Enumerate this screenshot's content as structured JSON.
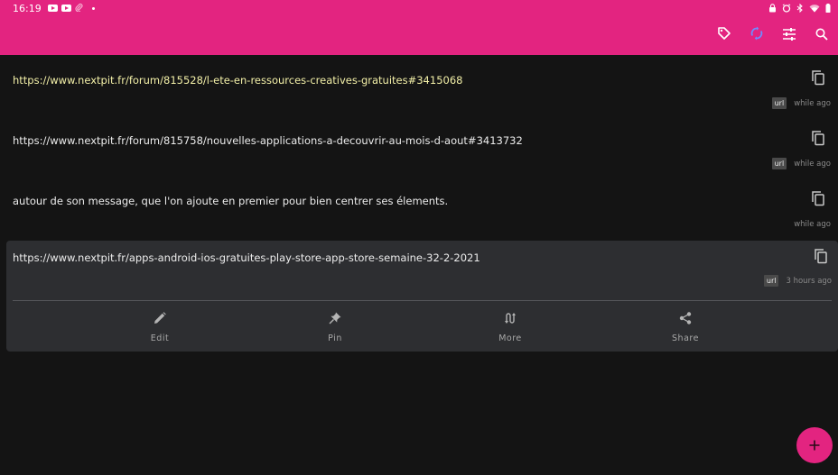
{
  "status_bar": {
    "time": "16:19",
    "left_icons": [
      "youtube-icon",
      "youtube-icon",
      "attachment-icon",
      "dot-icon"
    ],
    "right_icons": [
      "lock-icon",
      "alarm-icon",
      "bluetooth-icon",
      "wifi-icon",
      "battery-icon"
    ]
  },
  "app_bar": {
    "actions": [
      "tag-icon",
      "sync-icon",
      "filter-sliders-icon",
      "search-icon"
    ],
    "accent_color": "#e32480",
    "sync_color": "#6e8cff"
  },
  "items": [
    {
      "text": "https://www.nextpit.fr/forum/815528/l-ete-en-ressources-creatives-gratuites#3415068",
      "badge": "url",
      "time": "while ago",
      "highlighted": true
    },
    {
      "text": "https://www.nextpit.fr/forum/815758/nouvelles-applications-a-decouvrir-au-mois-d-aout#3413732",
      "badge": "url",
      "time": "while ago"
    },
    {
      "text": "autour de son message, que l'on ajoute en premier pour bien centrer ses élements.",
      "time": "while ago"
    },
    {
      "text": "https://www.nextpit.fr/apps-android-ios-gratuites-play-store-app-store-semaine-32-2-2021",
      "badge": "url",
      "time": "3 hours ago",
      "expanded": true
    }
  ],
  "expanded_actions": [
    {
      "label": "Edit",
      "icon": "pencil-icon"
    },
    {
      "label": "Pin",
      "icon": "pin-icon"
    },
    {
      "label": "More",
      "icon": "swap-icon"
    },
    {
      "label": "Share",
      "icon": "share-icon"
    }
  ],
  "fab": {
    "icon": "plus-icon",
    "label": "+"
  }
}
